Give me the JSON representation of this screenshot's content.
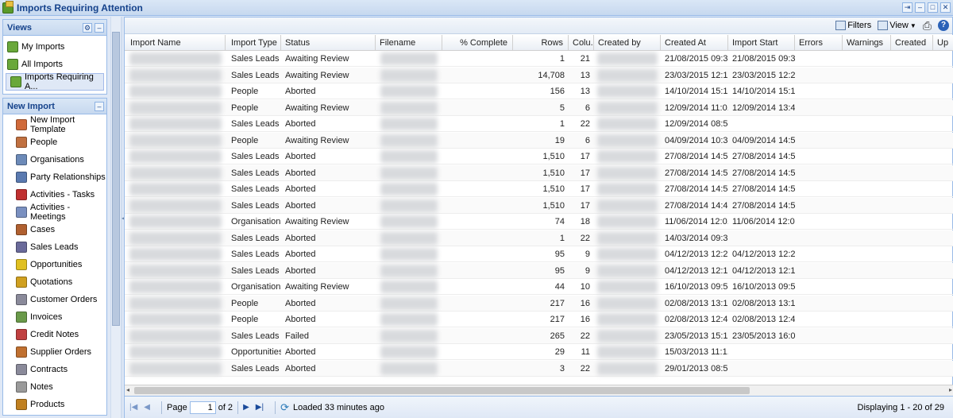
{
  "window": {
    "title": "Imports Requiring Attention"
  },
  "views": {
    "title": "Views",
    "items": [
      {
        "label": "My Imports"
      },
      {
        "label": "All Imports"
      },
      {
        "label": "Imports Requiring A..."
      }
    ]
  },
  "new_import": {
    "title": "New Import",
    "items": [
      {
        "label": "New Import Template",
        "icon": "template-icon",
        "color": "#d06a3a"
      },
      {
        "label": "People",
        "icon": "person-icon",
        "color": "#c07040"
      },
      {
        "label": "Organisations",
        "icon": "building-icon",
        "color": "#6c8ab8"
      },
      {
        "label": "Party Relationships",
        "icon": "relationship-icon",
        "color": "#5a7ab0"
      },
      {
        "label": "Activities - Tasks",
        "icon": "task-icon",
        "color": "#c03030"
      },
      {
        "label": "Activities - Meetings",
        "icon": "meeting-icon",
        "color": "#7a90c0"
      },
      {
        "label": "Cases",
        "icon": "cases-icon",
        "color": "#b06030"
      },
      {
        "label": "Sales Leads",
        "icon": "leads-icon",
        "color": "#6a6a9a"
      },
      {
        "label": "Opportunities",
        "icon": "funnel-icon",
        "color": "#e0c020"
      },
      {
        "label": "Quotations",
        "icon": "quotation-icon",
        "color": "#d0a020"
      },
      {
        "label": "Customer Orders",
        "icon": "order-icon",
        "color": "#8a8a9a"
      },
      {
        "label": "Invoices",
        "icon": "invoice-icon",
        "color": "#6a9a4a"
      },
      {
        "label": "Credit Notes",
        "icon": "credit-note-icon",
        "color": "#c04040"
      },
      {
        "label": "Supplier Orders",
        "icon": "supplier-order-icon",
        "color": "#c07030"
      },
      {
        "label": "Contracts",
        "icon": "contract-icon",
        "color": "#8a8a9a"
      },
      {
        "label": "Notes",
        "icon": "notes-icon",
        "color": "#9a9a9a"
      },
      {
        "label": "Products",
        "icon": "products-icon",
        "color": "#c08020"
      }
    ]
  },
  "toolbar": {
    "filters_label": "Filters",
    "view_label": "View"
  },
  "grid": {
    "columns": [
      "Import Name",
      "Import Type",
      "Status",
      "Filename",
      "% Complete",
      "Rows",
      "Colu...",
      "Created by",
      "Created At",
      "Import Start",
      "Errors",
      "Warnings",
      "Created",
      "Up"
    ],
    "rows": [
      {
        "type": "Sales Leads",
        "status": "Awaiting Review",
        "rows": "1",
        "cols": "21",
        "created_at": "21/08/2015 09:3...",
        "import_start": "21/08/2015 09:3..."
      },
      {
        "type": "Sales Leads",
        "status": "Awaiting Review",
        "rows": "14,708",
        "cols": "13",
        "created_at": "23/03/2015 12:1...",
        "import_start": "23/03/2015 12:2..."
      },
      {
        "type": "People",
        "status": "Aborted",
        "rows": "156",
        "cols": "13",
        "created_at": "14/10/2014 15:1...",
        "import_start": "14/10/2014 15:1..."
      },
      {
        "type": "People",
        "status": "Awaiting Review",
        "rows": "5",
        "cols": "6",
        "created_at": "12/09/2014 11:0...",
        "import_start": "12/09/2014 13:4..."
      },
      {
        "type": "Sales Leads",
        "status": "Aborted",
        "rows": "1",
        "cols": "22",
        "created_at": "12/09/2014 08:5...",
        "import_start": ""
      },
      {
        "type": "People",
        "status": "Awaiting Review",
        "rows": "19",
        "cols": "6",
        "created_at": "04/09/2014 10:3...",
        "import_start": "04/09/2014 14:5..."
      },
      {
        "type": "Sales Leads",
        "status": "Aborted",
        "rows": "1,510",
        "cols": "17",
        "created_at": "27/08/2014 14:5...",
        "import_start": "27/08/2014 14:5..."
      },
      {
        "type": "Sales Leads",
        "status": "Aborted",
        "rows": "1,510",
        "cols": "17",
        "created_at": "27/08/2014 14:5...",
        "import_start": "27/08/2014 14:5..."
      },
      {
        "type": "Sales Leads",
        "status": "Aborted",
        "rows": "1,510",
        "cols": "17",
        "created_at": "27/08/2014 14:5...",
        "import_start": "27/08/2014 14:5..."
      },
      {
        "type": "Sales Leads",
        "status": "Aborted",
        "rows": "1,510",
        "cols": "17",
        "created_at": "27/08/2014 14:4...",
        "import_start": "27/08/2014 14:5..."
      },
      {
        "type": "Organisations",
        "status": "Awaiting Review",
        "rows": "74",
        "cols": "18",
        "created_at": "11/06/2014 12:0...",
        "import_start": "11/06/2014 12:0..."
      },
      {
        "type": "Sales Leads",
        "status": "Aborted",
        "rows": "1",
        "cols": "22",
        "created_at": "14/03/2014 09:3...",
        "import_start": ""
      },
      {
        "type": "Sales Leads",
        "status": "Aborted",
        "rows": "95",
        "cols": "9",
        "created_at": "04/12/2013 12:2...",
        "import_start": "04/12/2013 12:2..."
      },
      {
        "type": "Sales Leads",
        "status": "Aborted",
        "rows": "95",
        "cols": "9",
        "created_at": "04/12/2013 12:1...",
        "import_start": "04/12/2013 12:1..."
      },
      {
        "type": "Organisations",
        "status": "Awaiting Review",
        "rows": "44",
        "cols": "10",
        "created_at": "16/10/2013 09:5...",
        "import_start": "16/10/2013 09:5..."
      },
      {
        "type": "People",
        "status": "Aborted",
        "rows": "217",
        "cols": "16",
        "created_at": "02/08/2013 13:1...",
        "import_start": "02/08/2013 13:1..."
      },
      {
        "type": "People",
        "status": "Aborted",
        "rows": "217",
        "cols": "16",
        "created_at": "02/08/2013 12:4...",
        "import_start": "02/08/2013 12:4..."
      },
      {
        "type": "Sales Leads",
        "status": "Failed",
        "rows": "265",
        "cols": "22",
        "created_at": "23/05/2013 15:1...",
        "import_start": "23/05/2013 16:0..."
      },
      {
        "type": "Opportunities",
        "status": "Aborted",
        "rows": "29",
        "cols": "11",
        "created_at": "15/03/2013 11:1...",
        "import_start": ""
      },
      {
        "type": "Sales Leads",
        "status": "Aborted",
        "rows": "3",
        "cols": "22",
        "created_at": "29/01/2013 08:5...",
        "import_start": ""
      }
    ]
  },
  "paging": {
    "page_label": "Page",
    "page_value": "1",
    "of_label": "of 2",
    "loaded_text": "Loaded 33 minutes ago",
    "display_text": "Displaying 1 - 20 of 29"
  }
}
